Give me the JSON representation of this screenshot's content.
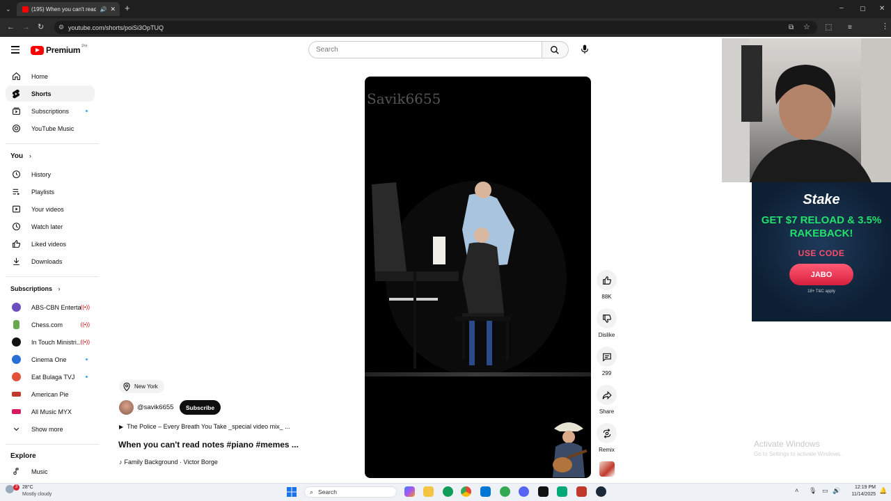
{
  "browser": {
    "tab_title": "(195) When you can't read",
    "url": "youtube.com/shorts/poiSi3OpTUQ"
  },
  "header": {
    "brand": "Premium",
    "country": "PH",
    "search_placeholder": "Search"
  },
  "sidebar": {
    "main": [
      {
        "label": "Home",
        "icon": "home-icon"
      },
      {
        "label": "Shorts",
        "icon": "shorts-icon",
        "active": true
      },
      {
        "label": "Subscriptions",
        "icon": "subscriptions-icon",
        "dot": true
      },
      {
        "label": "YouTube Music",
        "icon": "youtube-music-icon"
      }
    ],
    "you_heading": "You",
    "you": [
      {
        "label": "History",
        "icon": "history-icon"
      },
      {
        "label": "Playlists",
        "icon": "playlists-icon"
      },
      {
        "label": "Your videos",
        "icon": "your-videos-icon"
      },
      {
        "label": "Watch later",
        "icon": "watch-later-icon"
      },
      {
        "label": "Liked videos",
        "icon": "liked-videos-icon"
      },
      {
        "label": "Downloads",
        "icon": "downloads-icon"
      }
    ],
    "subs_heading": "Subscriptions",
    "subscriptions": [
      {
        "label": "ABS-CBN Enterta...",
        "live": true,
        "color": "#6b4fbf"
      },
      {
        "label": "Chess.com",
        "live": true,
        "color": "#6aa84f"
      },
      {
        "label": "In Touch Ministri...",
        "live": true,
        "color": "#111111"
      },
      {
        "label": "Cinema One",
        "dot": true,
        "color": "#2a6fd6"
      },
      {
        "label": "Eat Bulaga TVJ",
        "dot": true,
        "color": "#e0523a"
      },
      {
        "label": "American Pie",
        "color": "#c0392b"
      },
      {
        "label": "All Music MYX",
        "color": "#d81b60"
      }
    ],
    "show_more": "Show more",
    "explore_heading": "Explore",
    "explore": [
      {
        "label": "Music",
        "icon": "music-icon"
      }
    ]
  },
  "short": {
    "watermark": "Savik6655",
    "location": "New York",
    "channel": "@savik6655",
    "subscribe": "Subscribe",
    "music": "The Police – Every Breath You Take _special video mix_ ...",
    "title": "When you can't read notes #piano #memes ...",
    "sound": "Family Background · Victor Borge"
  },
  "actions": {
    "likes": "88K",
    "dislike": "Dislike",
    "comments": "299",
    "share": "Share",
    "remix": "Remix"
  },
  "ad": {
    "brand": "Stake",
    "headline": "GET $7 RELOAD & 3.5% RAKEBACK!",
    "use_code": "USE CODE",
    "code": "JABO",
    "terms": "18+ T&C apply"
  },
  "windows": {
    "activate_title": "Activate Windows",
    "activate_sub": "Go to Settings to activate Windows."
  },
  "taskbar": {
    "weather_temp": "28°C",
    "weather_desc": "Mostly cloudy",
    "weather_badge": "3",
    "search": "Search",
    "time": "12:19 PM",
    "date": "11/14/2025"
  }
}
